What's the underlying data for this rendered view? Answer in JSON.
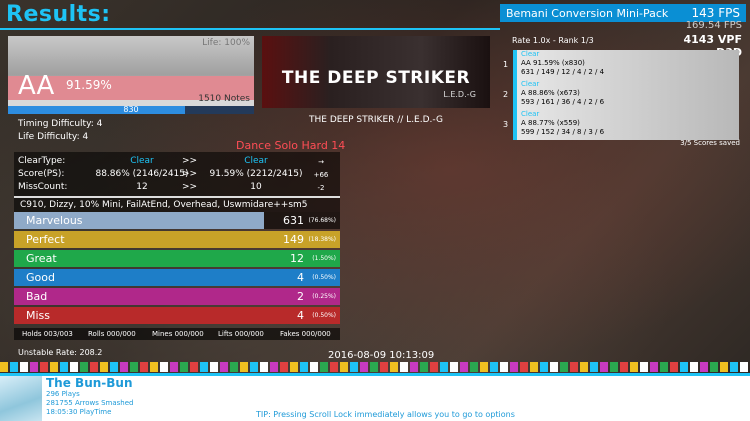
{
  "header": {
    "title": "Results:",
    "pack": "Bemani Conversion Mini-Pack",
    "fps": "143 FPS",
    "fps_sub": "169.54 FPS",
    "vpf": "4143 VPF",
    "renderer": "D3D"
  },
  "grade": {
    "life_label": "Life: 100%",
    "grade": "AA",
    "percent": "91.59%",
    "notes": "1510 Notes",
    "life_value": "830",
    "life_fraction": 0.72,
    "timing_difficulty": "Timing Difficulty: 4",
    "life_difficulty": "Life Difficulty: 4"
  },
  "song": {
    "banner_title": "THE DEEP STRIKER",
    "banner_artist": "L.E.D.-G",
    "line": "THE DEEP STRIKER // L.E.D.-G",
    "difficulty": "Dance Solo Hard 14"
  },
  "comparison": {
    "rows": [
      {
        "label": "ClearType:",
        "old": "Clear",
        "arrow": ">>",
        "new": "Clear",
        "diff": "→",
        "blue": true
      },
      {
        "label": "Score(PS):",
        "old": "88.86% (2146/2415)",
        "arrow": ">>",
        "new": "91.59% (2212/2415)",
        "diff": "+66",
        "blue": false
      },
      {
        "label": "MissCount:",
        "old": "12",
        "arrow": ">>",
        "new": "10",
        "diff": "-2",
        "blue": false
      }
    ]
  },
  "mods": "C910, Dizzy, 10% Mini, FailAtEnd, Overhead, Uswmidare++sm5",
  "judgments": [
    {
      "label": "Marvelous",
      "count": "631",
      "pct": "(76.68%)",
      "fraction": 0.7668,
      "color": "#8faac8"
    },
    {
      "label": "Perfect",
      "count": "149",
      "pct": "(18.38%)",
      "fraction": 1.0,
      "color": "#c8a228"
    },
    {
      "label": "Great",
      "count": "12",
      "pct": "(1.50%)",
      "fraction": 1.0,
      "color": "#1fa84a"
    },
    {
      "label": "Good",
      "count": "4",
      "pct": "(0.50%)",
      "fraction": 1.0,
      "color": "#1e7ec8"
    },
    {
      "label": "Bad",
      "count": "2",
      "pct": "(0.25%)",
      "fraction": 1.0,
      "color": "#b0288a"
    },
    {
      "label": "Miss",
      "count": "4",
      "pct": "(0.50%)",
      "fraction": 1.0,
      "color": "#b82a2a"
    }
  ],
  "holds": {
    "holds": "Holds 003/003",
    "rolls": "Rolls 000/000",
    "mines": "Mines 000/000",
    "lifts": "Lifts 000/000",
    "fakes": "Fakes 000/000"
  },
  "unstable_rate": "Unstable Rate: 208.2",
  "date": "2016-08-09 10:13:09",
  "scores": {
    "rate": "Rate 1.0x - Rank 1/3",
    "list": [
      {
        "idx": "1",
        "clear": "Clear",
        "line1": "AA 91.59% (x830)",
        "line2": "631 / 149 / 12 / 4 / 2 / 4"
      },
      {
        "idx": "2",
        "clear": "Clear",
        "line1": "A 88.86% (x673)",
        "line2": "593 / 161 / 36 / 4 / 2 / 6"
      },
      {
        "idx": "3",
        "clear": "Clear",
        "line1": "A 88.77% (x559)",
        "line2": "599 / 152 / 34 / 8 / 3 / 6"
      }
    ],
    "saved": "3/5 Scores saved"
  },
  "player": {
    "name": "The Bun-Bun",
    "plays": "296 Plays",
    "arrows": "281755 Arrows Smashed",
    "playtime": "18:05:30 PlayTime"
  },
  "tip": "TIP: Pressing Scroll Lock immediately allows you to go to options",
  "colors": {
    "accent": "#1ec3f5",
    "difficulty": "#ff4d55",
    "strip": [
      "#f0c020",
      "#1ec3f5",
      "#ffffff",
      "#c83ac0",
      "#2aa850",
      "#e04040"
    ]
  }
}
